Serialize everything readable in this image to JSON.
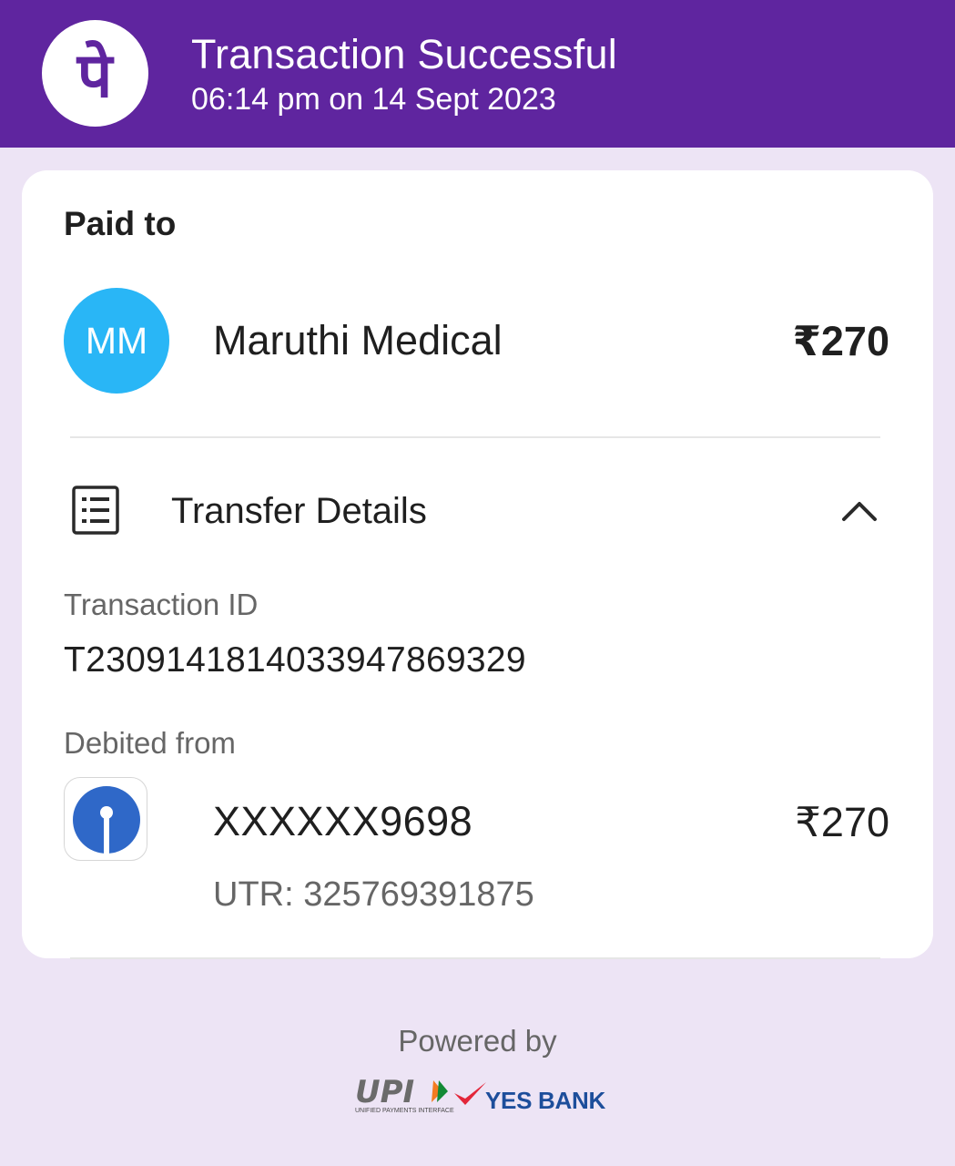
{
  "header": {
    "title": "Transaction Successful",
    "subtitle": "06:14 pm on 14 Sept 2023",
    "logo_icon": "phonepe-logo-icon",
    "brand_color": "#5f259f"
  },
  "payment": {
    "paid_to_label": "Paid to",
    "avatar_initials": "MM",
    "avatar_color": "#29b6f6",
    "payee_name": "Maruthi Medical",
    "amount": "₹270"
  },
  "transfer_details": {
    "title": "Transfer Details",
    "icon": "receipt-list-icon",
    "toggle_icon": "chevron-up-icon",
    "transaction_id_label": "Transaction ID",
    "transaction_id": "T2309141814033947869329",
    "debited_from_label": "Debited from",
    "bank_icon": "sbi-bank-logo-icon",
    "account": "XXXXXX9698",
    "amount": "₹270",
    "utr": "UTR: 325769391875"
  },
  "footer": {
    "powered_by": "Powered by",
    "upi_logo": "UPI",
    "upi_subtext": "UNIFIED PAYMENTS INTERFACE",
    "bank_logo": "YES BANK"
  }
}
